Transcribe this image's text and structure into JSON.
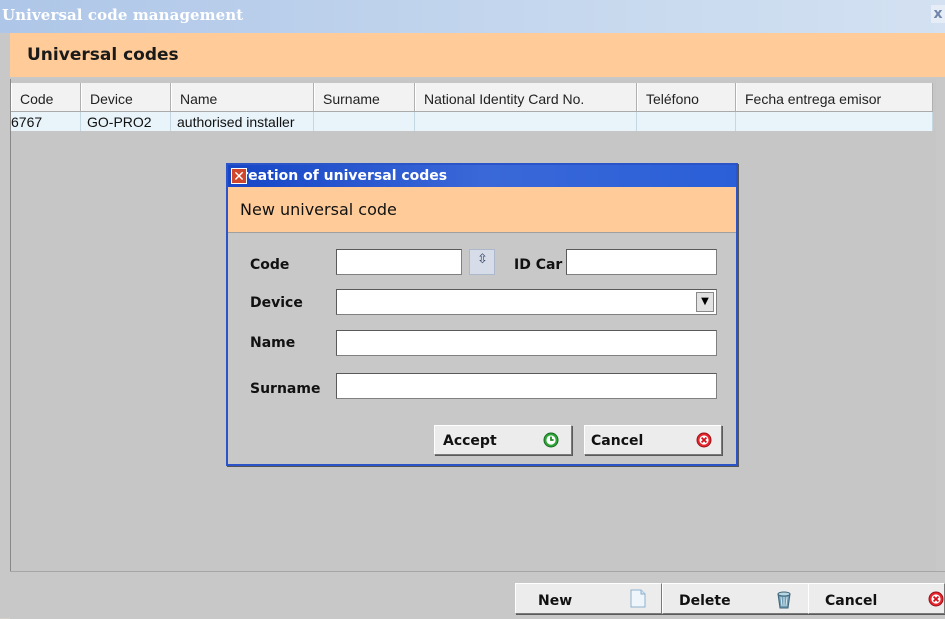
{
  "window": {
    "title": "Universal code management",
    "close_glyph": "x"
  },
  "main": {
    "section_title": "Universal codes",
    "grid": {
      "columns": [
        "Code",
        "Device",
        "Name",
        "Surname",
        "National Identity Card No.",
        "Teléfono",
        "Fecha entrega emisor"
      ],
      "rows": [
        {
          "code": "6767",
          "device": "GO-PRO2",
          "name": "authorised installer",
          "surname": "",
          "id_card": "",
          "telefono": "",
          "fecha": ""
        }
      ]
    }
  },
  "bottom_bar": {
    "new_label": "New",
    "delete_label": "Delete",
    "cancel_label": "Cancel",
    "new_icon": "document-icon",
    "delete_icon": "recycle-bin-icon",
    "cancel_icon": "red-x-circle-icon"
  },
  "dialog": {
    "title": "Creation of universal codes",
    "header": "New universal code",
    "fields": {
      "code_label": "Code",
      "id_card_label": "ID Car",
      "device_label": "Device",
      "name_label": "Name",
      "surname_label": "Surname",
      "code_value": "",
      "id_card_value": "",
      "device_value": "",
      "name_value": "",
      "surname_value": ""
    },
    "accept_label": "Accept",
    "cancel_label": "Cancel",
    "accept_icon": "green-check-circle-icon",
    "cancel_icon": "red-x-circle-icon"
  },
  "colors": {
    "header_bg": "#ffcc99",
    "dialog_title_bg": "#1746c7",
    "row_bg": "#e8f4fa"
  }
}
